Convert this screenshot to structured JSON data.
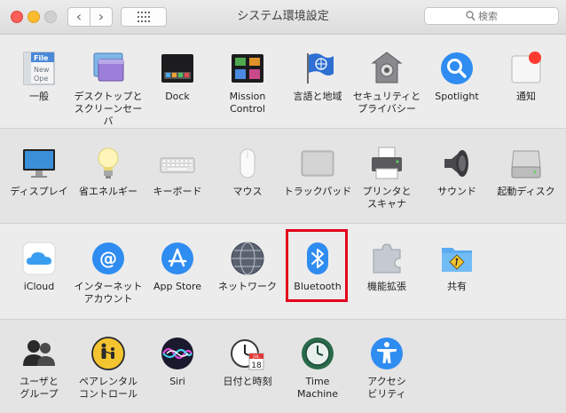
{
  "window": {
    "title": "システム環境設定"
  },
  "toolbar": {
    "back_glyph": "‹",
    "forward_glyph": "›"
  },
  "search": {
    "placeholder": "検索",
    "value": ""
  },
  "icons": {
    "general": "general-icon",
    "desktop": "desktop-screensaver-icon",
    "dock": "dock-icon",
    "mission": "mission-control-icon",
    "language": "language-region-icon",
    "security": "security-privacy-icon",
    "spotlight": "spotlight-icon",
    "notifications": "notifications-icon",
    "displays": "displays-icon",
    "energy": "energy-saver-icon",
    "keyboard": "keyboard-icon",
    "mouse": "mouse-icon",
    "trackpad": "trackpad-icon",
    "printers": "printers-scanners-icon",
    "sound": "sound-icon",
    "startup": "startup-disk-icon",
    "icloud": "icloud-icon",
    "internet_accounts": "internet-accounts-icon",
    "appstore": "app-store-icon",
    "network": "network-icon",
    "bluetooth": "bluetooth-icon",
    "extensions": "extensions-icon",
    "sharing": "sharing-icon",
    "users": "users-groups-icon",
    "parental": "parental-controls-icon",
    "siri": "siri-icon",
    "datetime": "date-time-icon",
    "timemachine": "time-machine-icon",
    "accessibility": "accessibility-icon"
  },
  "colors": {
    "highlight": "#e3001b",
    "close": "#fc5f57",
    "minimize": "#fdbc2e",
    "badge": "#ff3b30"
  },
  "icon_text": {
    "general_file": "File",
    "general_new": "New",
    "general_open": "Ope",
    "calendar_month": "JUL",
    "calendar_day": "18"
  },
  "rows": [
    [
      {
        "key": "general",
        "label": "一般"
      },
      {
        "key": "desktop",
        "label": "デスクトップと\nスクリーンセーバ"
      },
      {
        "key": "dock",
        "label": "Dock"
      },
      {
        "key": "mission",
        "label": "Mission\nControl"
      },
      {
        "key": "language",
        "label": "言語と地域"
      },
      {
        "key": "security",
        "label": "セキュリティと\nプライバシー"
      },
      {
        "key": "spotlight",
        "label": "Spotlight"
      },
      {
        "key": "notifications",
        "label": "通知"
      }
    ],
    [
      {
        "key": "displays",
        "label": "ディスプレイ"
      },
      {
        "key": "energy",
        "label": "省エネルギー"
      },
      {
        "key": "keyboard",
        "label": "キーボード"
      },
      {
        "key": "mouse",
        "label": "マウス"
      },
      {
        "key": "trackpad",
        "label": "トラックパッド"
      },
      {
        "key": "printers",
        "label": "プリンタと\nスキャナ"
      },
      {
        "key": "sound",
        "label": "サウンド"
      },
      {
        "key": "startup",
        "label": "起動ディスク"
      }
    ],
    [
      {
        "key": "icloud",
        "label": "iCloud"
      },
      {
        "key": "internet_accounts",
        "label": "インターネット\nアカウント"
      },
      {
        "key": "appstore",
        "label": "App Store"
      },
      {
        "key": "network",
        "label": "ネットワーク"
      },
      {
        "key": "bluetooth",
        "label": "Bluetooth"
      },
      {
        "key": "extensions",
        "label": "機能拡張"
      },
      {
        "key": "sharing",
        "label": "共有"
      }
    ],
    [
      {
        "key": "users",
        "label": "ユーザと\nグループ"
      },
      {
        "key": "parental",
        "label": "ペアレンタル\nコントロール"
      },
      {
        "key": "siri",
        "label": "Siri"
      },
      {
        "key": "datetime",
        "label": "日付と時刻"
      },
      {
        "key": "timemachine",
        "label": "Time\nMachine"
      },
      {
        "key": "accessibility",
        "label": "アクセシ\nビリティ"
      }
    ]
  ]
}
